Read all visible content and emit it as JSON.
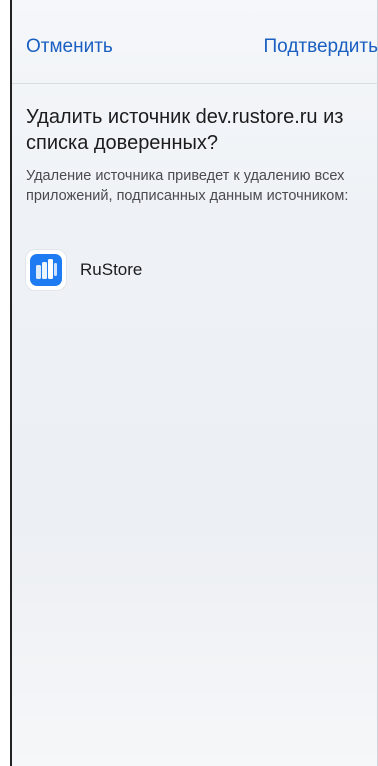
{
  "header": {
    "cancel_label": "Отменить",
    "confirm_label": "Подтвердить"
  },
  "dialog": {
    "title": "Удалить источник dev.rustore.ru из списка доверенных?",
    "description": "Удаление источника приведет к удалению всех приложений, подписанных данным источником:"
  },
  "apps": [
    {
      "name": "RuStore",
      "icon": "rustore-logo-icon"
    }
  ],
  "colors": {
    "accent": "#1a5fc1",
    "title_text": "#1c1c1e",
    "body_text": "#4a4a4f",
    "icon_blue": "#1f7bf2"
  }
}
